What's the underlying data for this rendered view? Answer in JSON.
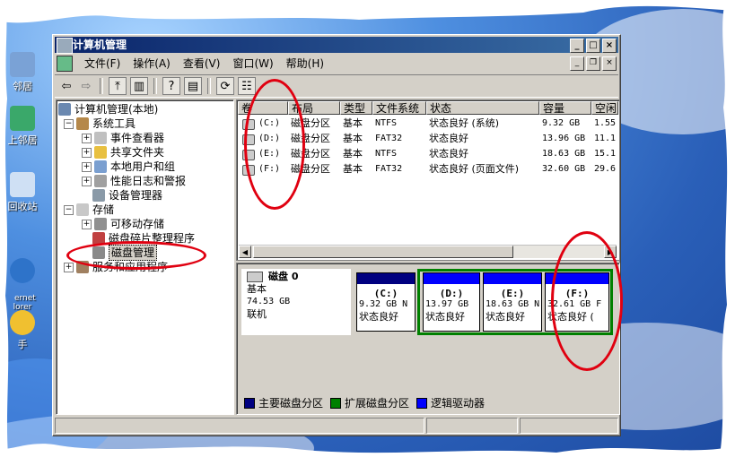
{
  "window": {
    "title": "计算机管理"
  },
  "menu": {
    "items": [
      "文件(F)",
      "操作(A)",
      "查看(V)",
      "窗口(W)",
      "帮助(H)"
    ]
  },
  "desktop": {
    "icons": [
      "邻居",
      "上邻居",
      "回收站",
      "ernet\nlorer",
      "手"
    ]
  },
  "tree": {
    "root": "计算机管理(本地)",
    "system_tools": "系统工具",
    "event_viewer": "事件查看器",
    "shared_folders": "共享文件夹",
    "local_users": "本地用户和组",
    "perf_logs": "性能日志和警报",
    "device_manager": "设备管理器",
    "storage": "存储",
    "removable_storage": "可移动存储",
    "defrag": "磁盘碎片整理程序",
    "disk_management": "磁盘管理",
    "services_apps": "服务和应用程序"
  },
  "volumes": {
    "headers": [
      "卷",
      "布局",
      "类型",
      "文件系统",
      "状态",
      "容量",
      "空闲"
    ],
    "rows": [
      [
        "(C:)",
        "磁盘分区",
        "基本",
        "NTFS",
        "状态良好 (系统)",
        "9.32 GB",
        "1.55"
      ],
      [
        "(D:)",
        "磁盘分区",
        "基本",
        "FAT32",
        "状态良好",
        "13.96 GB",
        "11.1"
      ],
      [
        "(E:)",
        "磁盘分区",
        "基本",
        "NTFS",
        "状态良好",
        "18.63 GB",
        "15.1"
      ],
      [
        "(F:)",
        "磁盘分区",
        "基本",
        "FAT32",
        "状态良好 (页面文件)",
        "32.60 GB",
        "29.6"
      ]
    ]
  },
  "disk": {
    "name": "磁盘 0",
    "type": "基本",
    "size": "74.53 GB",
    "state": "联机",
    "partitions": [
      {
        "label": "(C:)",
        "size": "9.32 GB N",
        "status": "状态良好"
      },
      {
        "label": "(D:)",
        "size": "13.97 GB",
        "status": "状态良好"
      },
      {
        "label": "(E:)",
        "size": "18.63 GB N",
        "status": "状态良好"
      },
      {
        "label": "(F:)",
        "size": "32.61 GB F",
        "status": "状态良好 ("
      }
    ]
  },
  "legend": {
    "primary": "主要磁盘分区",
    "extended": "扩展磁盘分区",
    "logical": "逻辑驱动器"
  },
  "colors": {
    "primary": "#000080",
    "extended": "#008000",
    "logical": "#0000ff",
    "annotation": "#e00010"
  }
}
